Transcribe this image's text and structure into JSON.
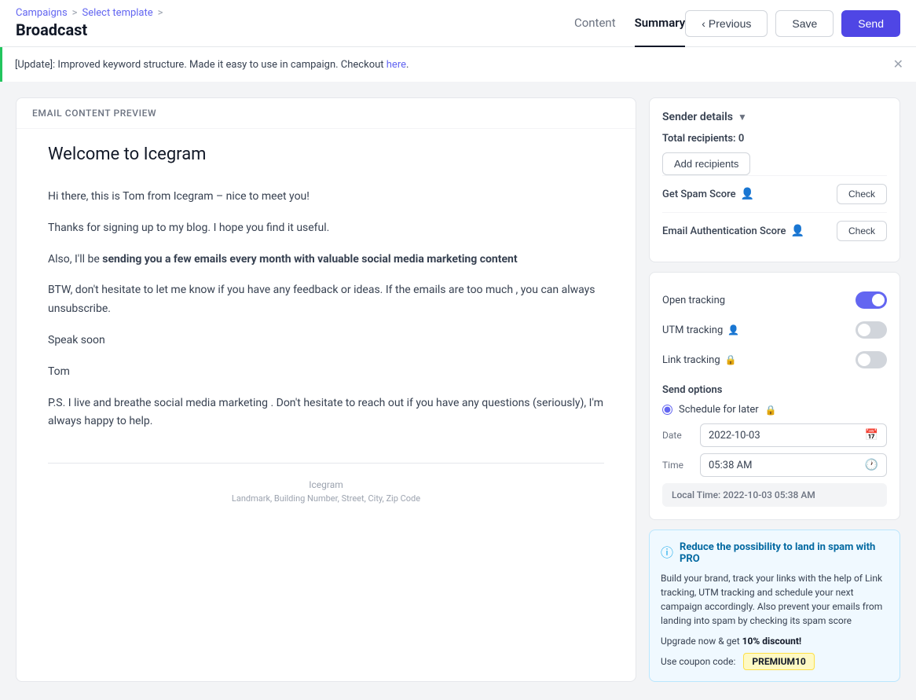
{
  "breadcrumb": {
    "campaigns": "Campaigns",
    "sep1": ">",
    "select_template": "Select template",
    "sep2": ">"
  },
  "page_title": "Broadcast",
  "tabs": [
    {
      "id": "content",
      "label": "Content",
      "active": false
    },
    {
      "id": "summary",
      "label": "Summary",
      "active": true
    }
  ],
  "buttons": {
    "previous": "Previous",
    "save": "Save",
    "send": "Send",
    "check": "Check",
    "add_recipients": "Add recipients"
  },
  "notification": {
    "text_prefix": "[Update]: Improved keyword structure. Made it easy to use in campaign. Checkout",
    "link_text": "here",
    "link_url": "#"
  },
  "email_preview": {
    "label": "Email Content Preview",
    "subject": "Welcome to Icegram",
    "body": [
      "Hi there, this is Tom from Icegram – nice to meet you!",
      "Thanks for signing up to my blog. I hope you find it useful.",
      "Also, I'll be sending you a few emails every month with valuable social media marketing content",
      "BTW, don't hesitate to let me know if you have any feedback or ideas. If the emails are too much , you can always unsubscribe.",
      "Speak soon",
      "Tom",
      "P.S. I live and breathe social media marketing . Don't hesitate to reach out if you have any questions (seriously), I'm always happy to help."
    ],
    "footer_company": "Icegram",
    "footer_address": "Landmark, Building Number, Street, City, Zip Code"
  },
  "sidebar": {
    "sender_details_label": "Sender details",
    "total_recipients_label": "Total recipients:",
    "total_recipients_count": "0",
    "spam_score_label": "Get Spam Score",
    "auth_score_label": "Email Authentication Score",
    "tracking": {
      "open_tracking": "Open tracking",
      "utm_tracking": "UTM tracking",
      "link_tracking": "Link tracking"
    },
    "send_options_label": "Send options",
    "schedule_label": "Schedule for later",
    "date_label": "Date",
    "date_value": "2022-10-03",
    "time_label": "Time",
    "time_value": "05:38 AM",
    "local_time_label": "Local Time:",
    "local_time_value": "2022-10-03 05:38 AM"
  },
  "pro_upsell": {
    "title": "Reduce the possibility to land in spam with PRO",
    "body": "Build your brand, track your links with the help of Link tracking, UTM tracking and schedule your next campaign accordingly. Also prevent your emails from landing into spam by checking its spam score",
    "upgrade_text": "Upgrade now & get",
    "discount": "10% discount!",
    "coupon_label": "Use coupon code:",
    "coupon_code": "PREMIUM10"
  }
}
